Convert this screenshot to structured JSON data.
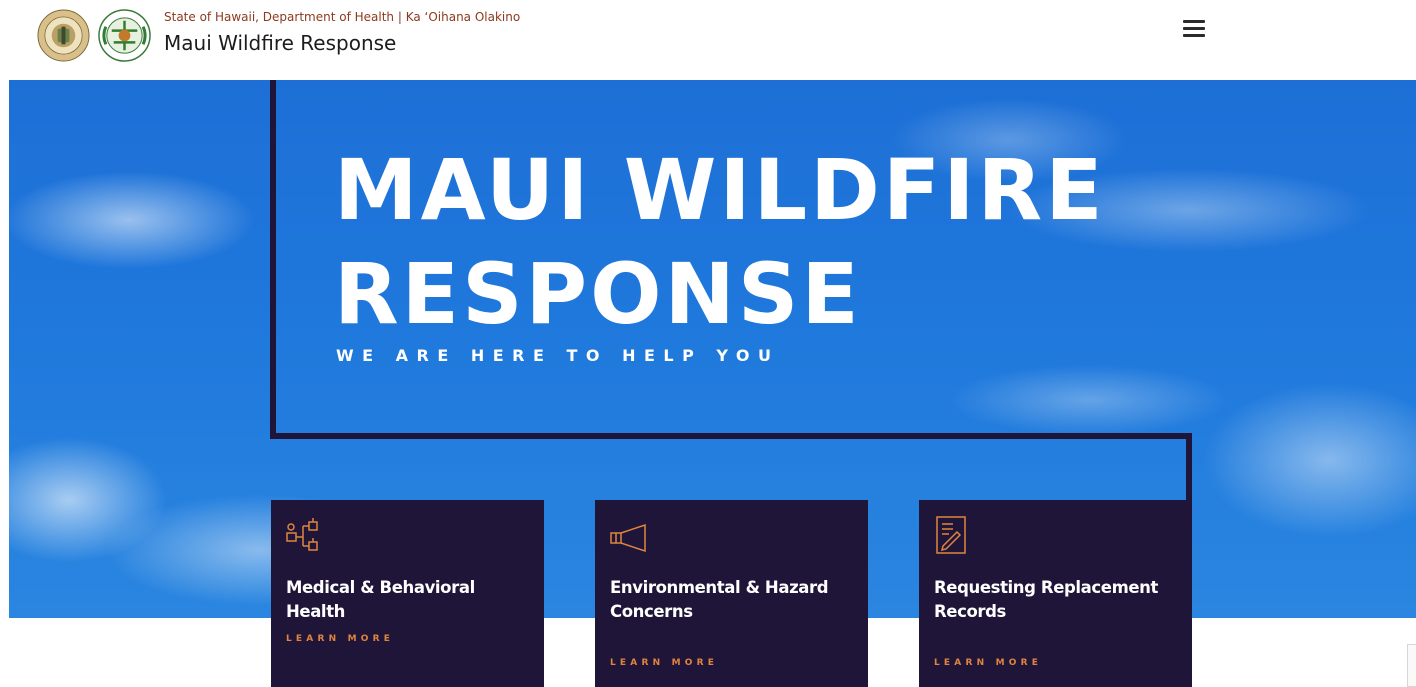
{
  "header": {
    "agency": "State of Hawaii, Department of Health | Ka ʻOihana Olakino",
    "site_title": "Maui Wildfire Response",
    "state_seal_icon": "state-of-hawaii-seal-icon",
    "doh_seal_icon": "department-of-health-seal-icon",
    "menu_icon": "hamburger-menu-icon"
  },
  "hero": {
    "title_line1": "MAUI WILDFIRE",
    "title_line2": "RESPONSE",
    "tagline": "WE ARE HERE TO HELP YOU"
  },
  "cards": [
    {
      "icon": "org-chart-icon",
      "title": "Medical & Behavioral Health",
      "link": "LEARN MORE"
    },
    {
      "icon": "megaphone-icon",
      "title": "Environmental & Hazard Concerns",
      "link": "LEARN MORE"
    },
    {
      "icon": "document-edit-icon",
      "title": "Requesting Replacement Records",
      "link": "LEARN MORE"
    }
  ],
  "colors": {
    "header_bg": "#ffffff",
    "agency_text": "#8b3a1d",
    "sky_blue": "#1f78dc",
    "card_bg": "#1f1538",
    "accent_orange": "#e0843f"
  }
}
